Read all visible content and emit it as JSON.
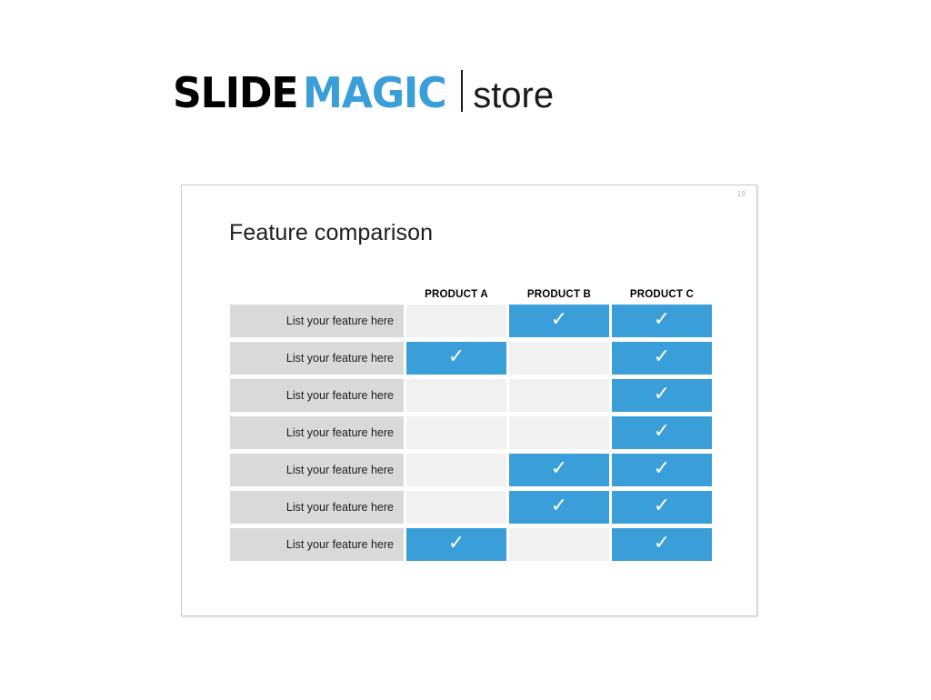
{
  "brand": {
    "slide_text": "SLIDE",
    "magic_text": "MAGIC",
    "store_text": "store",
    "accent_color": "#3a9ed9",
    "dark_color": "#000000"
  },
  "slide": {
    "number": "19",
    "title": "Feature comparison",
    "colors": {
      "accent": "#3a9ed9",
      "label_bg": "#d9d9d9",
      "empty_cell_bg": "#f1f1f1",
      "border": "#c8c8c8"
    },
    "table": {
      "columns": [
        "PRODUCT A",
        "PRODUCT B",
        "PRODUCT C"
      ],
      "check_glyph": "✓",
      "rows": [
        {
          "label": "List your feature here",
          "values": [
            false,
            true,
            true
          ]
        },
        {
          "label": "List your feature here",
          "values": [
            true,
            false,
            true
          ]
        },
        {
          "label": "List your feature here",
          "values": [
            false,
            false,
            true
          ]
        },
        {
          "label": "List your feature here",
          "values": [
            false,
            false,
            true
          ]
        },
        {
          "label": "List your feature here",
          "values": [
            false,
            true,
            true
          ]
        },
        {
          "label": "List your feature here",
          "values": [
            false,
            true,
            true
          ]
        },
        {
          "label": "List your feature here",
          "values": [
            true,
            false,
            true
          ]
        }
      ]
    }
  }
}
